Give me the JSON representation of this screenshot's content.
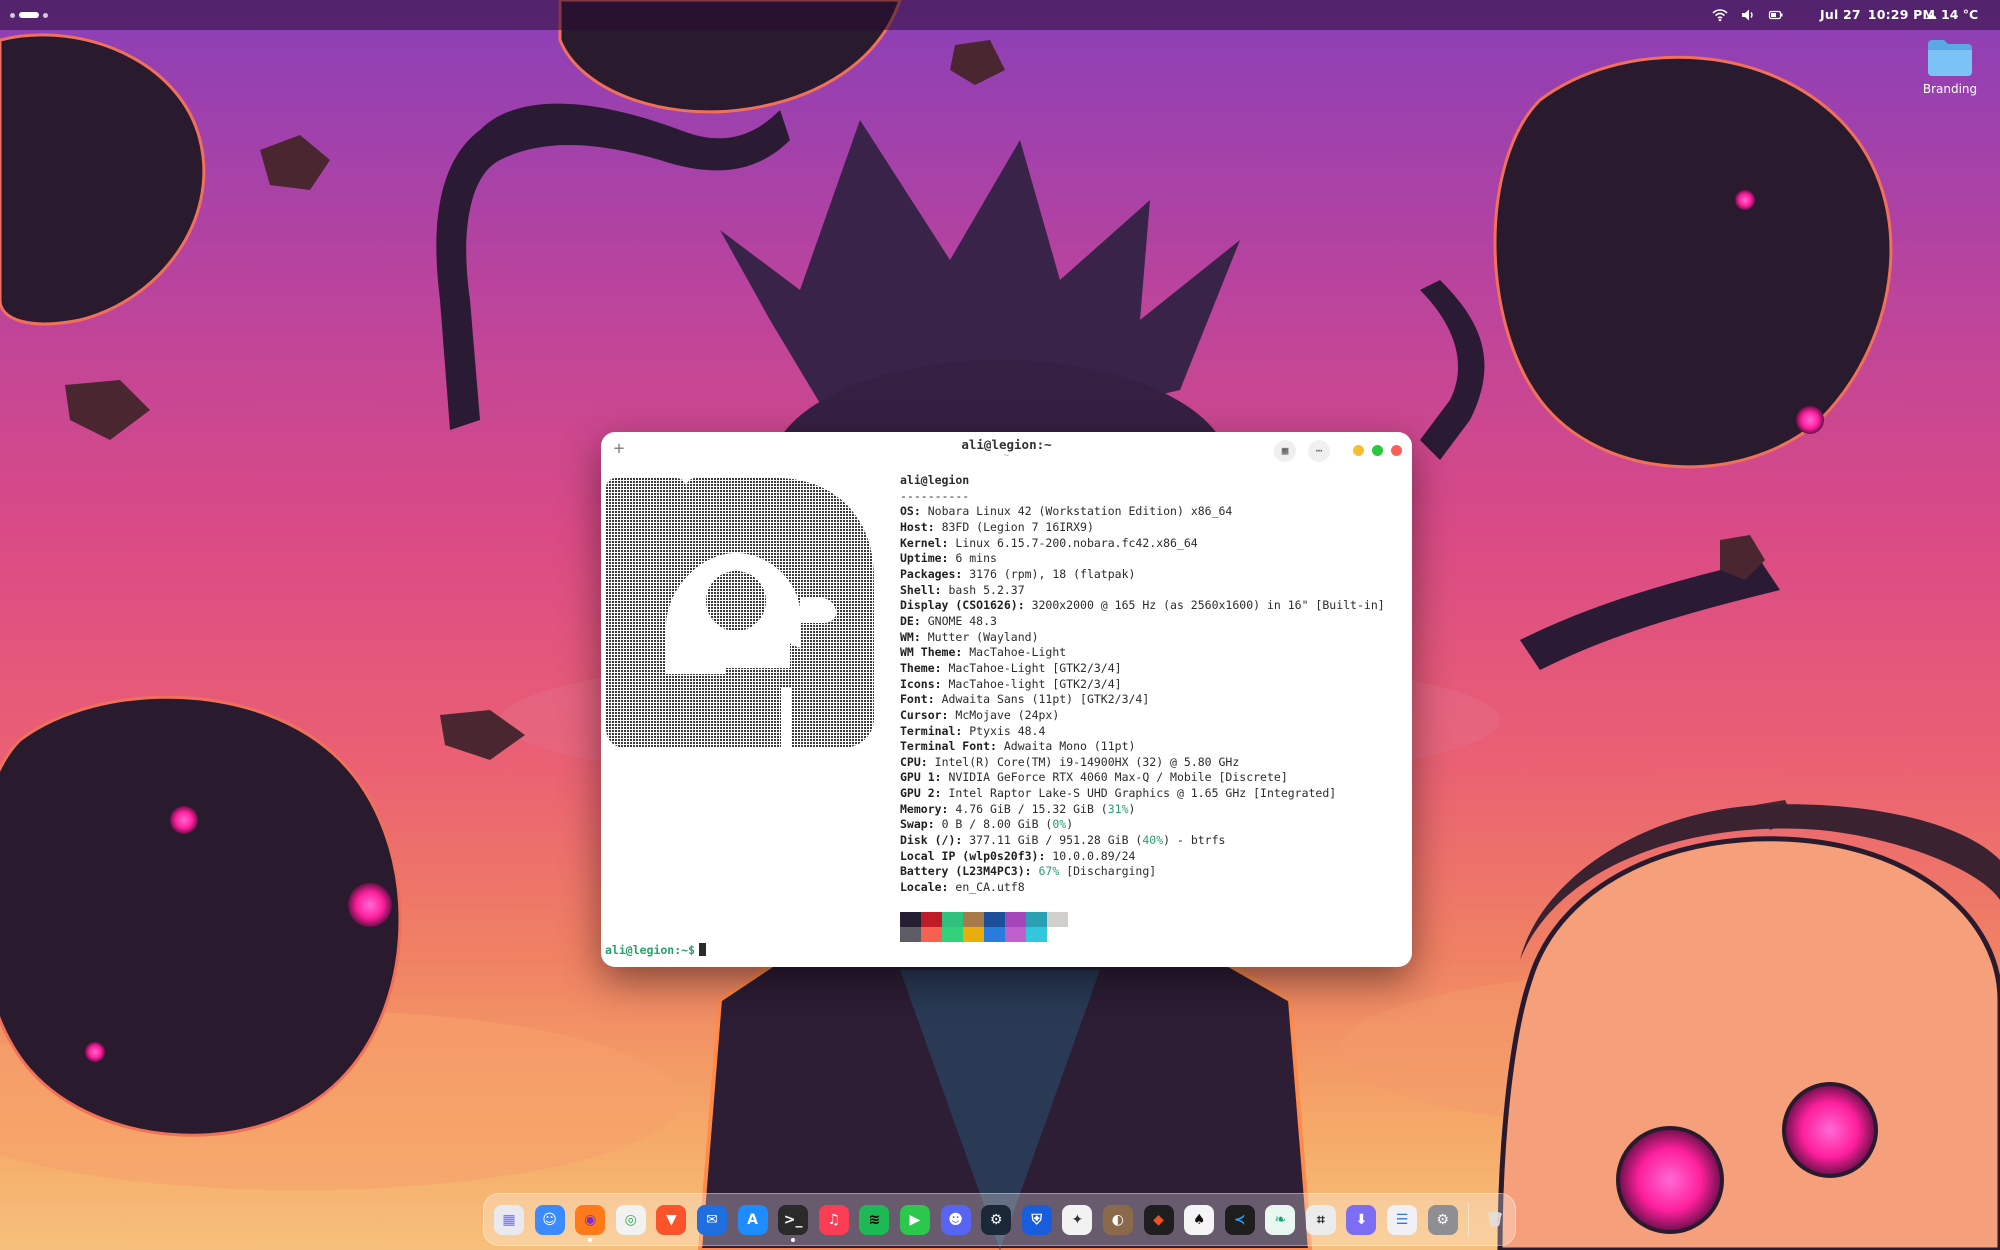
{
  "topbar": {
    "date": "Jul 27",
    "time": "10:29 PM",
    "temperature": "14 °C",
    "weather_icon": "cloud-icon",
    "tray_icons": [
      "wifi-icon",
      "volume-icon",
      "battery-icon"
    ]
  },
  "desktop": {
    "icons": [
      {
        "label": "Branding",
        "icon": "folder-icon"
      }
    ]
  },
  "terminal": {
    "title": "ali@legion:~",
    "subtitle": "~",
    "user_host": "ali@legion",
    "separator": "----------",
    "info": [
      {
        "key": "OS",
        "value": "Nobara Linux 42 (Workstation Edition) x86_64"
      },
      {
        "key": "Host",
        "value": "83FD (Legion 7 16IRX9)"
      },
      {
        "key": "Kernel",
        "value": "Linux 6.15.7-200.nobara.fc42.x86_64"
      },
      {
        "key": "Uptime",
        "value": "6 mins"
      },
      {
        "key": "Packages",
        "value": "3176 (rpm), 18 (flatpak)"
      },
      {
        "key": "Shell",
        "value": "bash 5.2.37"
      },
      {
        "key": "Display (CSO1626)",
        "value": "3200x2000 @ 165 Hz (as 2560x1600) in 16\" [Built-in]"
      },
      {
        "key": "DE",
        "value": "GNOME 48.3"
      },
      {
        "key": "WM",
        "value": "Mutter (Wayland)"
      },
      {
        "key": "WM Theme",
        "value": "MacTahoe-Light"
      },
      {
        "key": "Theme",
        "value": "MacTahoe-Light [GTK2/3/4]"
      },
      {
        "key": "Icons",
        "value": "MacTahoe-light [GTK2/3/4]"
      },
      {
        "key": "Font",
        "value": "Adwaita Sans (11pt) [GTK2/3/4]"
      },
      {
        "key": "Cursor",
        "value": "McMojave (24px)"
      },
      {
        "key": "Terminal",
        "value": "Ptyxis 48.4"
      },
      {
        "key": "Terminal Font",
        "value": "Adwaita Mono (11pt)"
      },
      {
        "key": "CPU",
        "value": "Intel(R) Core(TM) i9-14900HX (32) @ 5.80 GHz"
      },
      {
        "key": "GPU 1",
        "value": "NVIDIA GeForce RTX 4060 Max-Q / Mobile [Discrete]"
      },
      {
        "key": "GPU 2",
        "value": "Intel Raptor Lake-S UHD Graphics @ 1.65 GHz [Integrated]"
      },
      {
        "key": "Memory",
        "value": "4.76 GiB / 15.32 GiB (",
        "pct": "31%",
        "tail": ")"
      },
      {
        "key": "Swap",
        "value": "0 B / 8.00 GiB (",
        "pct": "0%",
        "tail": ")"
      },
      {
        "key": "Disk (/)",
        "value": "377.11 GiB / 951.28 GiB (",
        "pct": "40%",
        "tail": ") - btrfs"
      },
      {
        "key": "Local IP (wlp0s20f3)",
        "value": "10.0.0.89/24"
      },
      {
        "key": "Battery (L23M4PC3)",
        "value": "",
        "pct": "67%",
        "tail": " [Discharging]"
      },
      {
        "key": "Locale",
        "value": "en_CA.utf8"
      }
    ],
    "palette_top": [
      "#241f31",
      "#c01c28",
      "#2ec27e",
      "#a87a4a",
      "#1e4f9a",
      "#a347ba",
      "#2aa1b3",
      "#d0cfcc"
    ],
    "palette_bottom": [
      "#5e5c64",
      "#f66151",
      "#33d17a",
      "#e9ad0c",
      "#2a7bde",
      "#c061cb",
      "#33c7de"
    ],
    "prompt": "ali@legion:~$"
  },
  "dock": {
    "apps": [
      {
        "name": "launchpad",
        "label": "▦",
        "color": "#e9e9ef",
        "fg": "#6a6aff"
      },
      {
        "name": "finder",
        "label": "☺",
        "color": "#3b8bff",
        "fg": "#fff"
      },
      {
        "name": "firefox",
        "label": "◉",
        "color": "#ff7a1a",
        "fg": "#7a2fd0"
      },
      {
        "name": "chrome",
        "label": "◎",
        "color": "#f2f2f2",
        "fg": "#34a853"
      },
      {
        "name": "brave",
        "label": "▼",
        "color": "#fb542b",
        "fg": "#fff"
      },
      {
        "name": "thunderbird",
        "label": "✉",
        "color": "#1f6fe0",
        "fg": "#fff"
      },
      {
        "name": "app-store",
        "label": "A",
        "color": "#1c8cff",
        "fg": "#fff"
      },
      {
        "name": "terminal",
        "label": ">_",
        "color": "#2a2a2a",
        "fg": "#fff"
      },
      {
        "name": "music",
        "label": "♫",
        "color": "#fa3c55",
        "fg": "#fff"
      },
      {
        "name": "spotify",
        "label": "≋",
        "color": "#1db954",
        "fg": "#000"
      },
      {
        "name": "facetime",
        "label": "▶",
        "color": "#2cc84d",
        "fg": "#fff"
      },
      {
        "name": "discord",
        "label": "☻",
        "color": "#5865f2",
        "fg": "#fff"
      },
      {
        "name": "steam",
        "label": "⚙",
        "color": "#1b2838",
        "fg": "#fff"
      },
      {
        "name": "bitwarden",
        "label": "⛨",
        "color": "#175ddc",
        "fg": "#fff"
      },
      {
        "name": "games",
        "label": "✦",
        "color": "#f2f2f2",
        "fg": "#333"
      },
      {
        "name": "gimp",
        "label": "◐",
        "color": "#8a6a4a",
        "fg": "#fff"
      },
      {
        "name": "figma",
        "label": "◆",
        "color": "#1e1e1e",
        "fg": "#f24e1e"
      },
      {
        "name": "inkscape",
        "label": "♠",
        "color": "#f5f5f5",
        "fg": "#111"
      },
      {
        "name": "vscode",
        "label": "≺",
        "color": "#1e1e1e",
        "fg": "#2f9bf0"
      },
      {
        "name": "books",
        "label": "❧",
        "color": "#e9f7f1",
        "fg": "#1aa37a"
      },
      {
        "name": "screenshot",
        "label": "⌗",
        "color": "#ececec",
        "fg": "#222"
      },
      {
        "name": "downloader",
        "label": "⬇",
        "color": "#7c6df2",
        "fg": "#fff"
      },
      {
        "name": "settings-panel",
        "label": "☰",
        "color": "#f0f0f5",
        "fg": "#2a7bde"
      },
      {
        "name": "settings",
        "label": "⚙",
        "color": "#8e8e93",
        "fg": "#fff"
      }
    ],
    "trash": {
      "name": "trash",
      "label": "🗑",
      "color": "rgba(255,255,255,0.0)",
      "fg": "#e0e0e0"
    }
  }
}
